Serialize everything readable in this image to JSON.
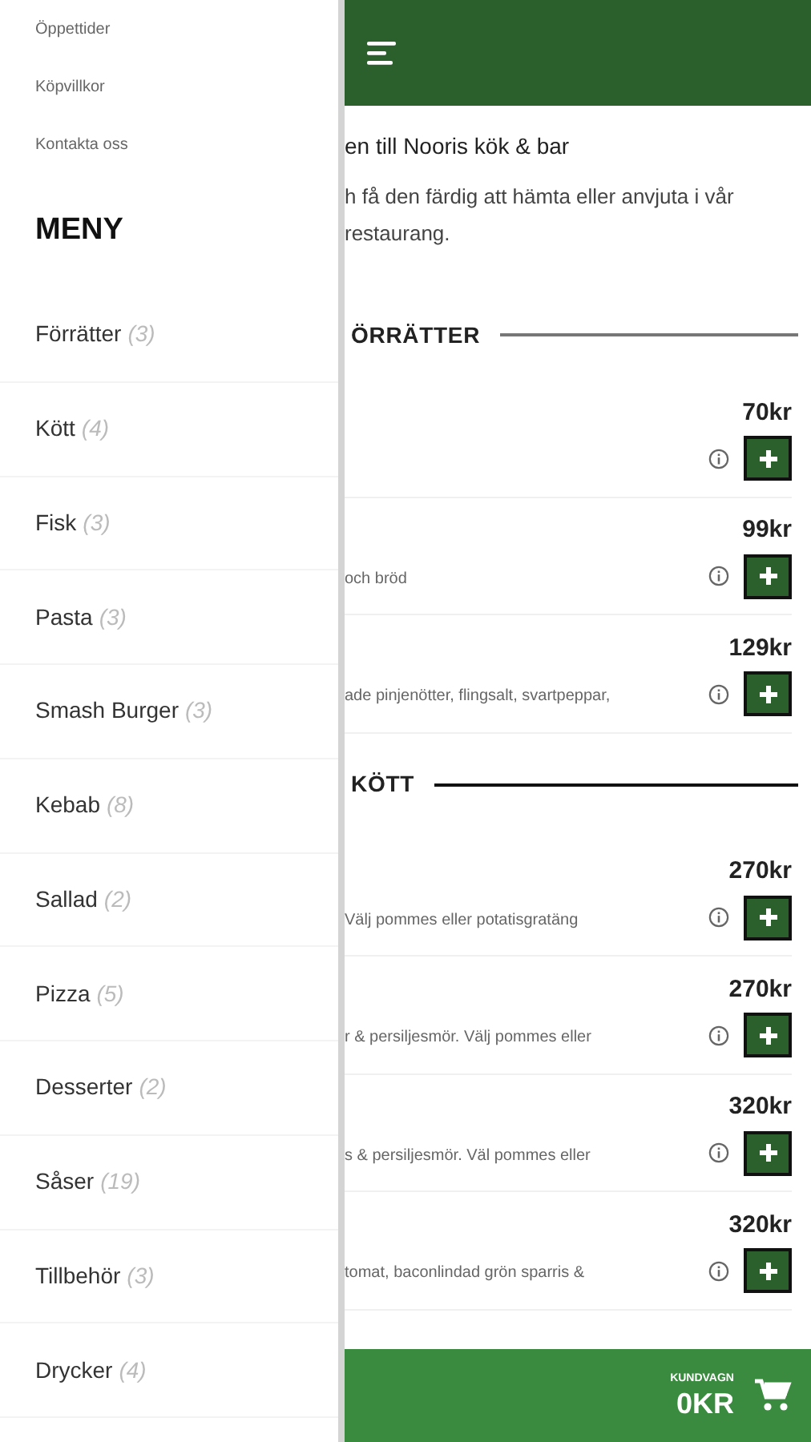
{
  "drawer": {
    "links": [
      "Öppettider",
      "Köpvillkor",
      "Kontakta oss"
    ],
    "menu_title": "MENY",
    "categories": [
      {
        "name": "Förrätter",
        "count": "(3)"
      },
      {
        "name": "Kött",
        "count": "(4)"
      },
      {
        "name": "Fisk",
        "count": "(3)"
      },
      {
        "name": "Pasta",
        "count": "(3)"
      },
      {
        "name": "Smash Burger",
        "count": "(3)"
      },
      {
        "name": "Kebab",
        "count": "(8)"
      },
      {
        "name": "Sallad",
        "count": "(2)"
      },
      {
        "name": "Pizza",
        "count": "(5)"
      },
      {
        "name": "Desserter",
        "count": "(2)"
      },
      {
        "name": "Såser",
        "count": "(19)"
      },
      {
        "name": "Tillbehör",
        "count": "(3)"
      },
      {
        "name": "Drycker",
        "count": "(4)"
      }
    ]
  },
  "intro": {
    "heading": "en till Nooris kök & bar",
    "text": "h få den färdig att hämta eller anvjuta  i vår restaurang."
  },
  "sections": [
    {
      "title": "ÖRRÄTTER",
      "items": [
        {
          "price": "70kr"
        },
        {
          "description": "och bröd",
          "price": "99kr"
        },
        {
          "description": "ade pinjenötter, flingsalt, svartpeppar,",
          "price": "129kr"
        }
      ]
    },
    {
      "title": "KÖTT",
      "items": [
        {
          "description": "Välj pommes eller potatisgratäng",
          "price": "270kr"
        },
        {
          "description": "r & persiljesmör. Välj pommes eller",
          "price": "270kr"
        },
        {
          "description": "s & persiljesmör. Väl pommes eller",
          "price": "320kr"
        },
        {
          "description": "tomat, baconlindad grön sparris &",
          "price": "320kr"
        }
      ]
    }
  ],
  "cart": {
    "label": "KUNDVAGN",
    "total": "0KR"
  }
}
